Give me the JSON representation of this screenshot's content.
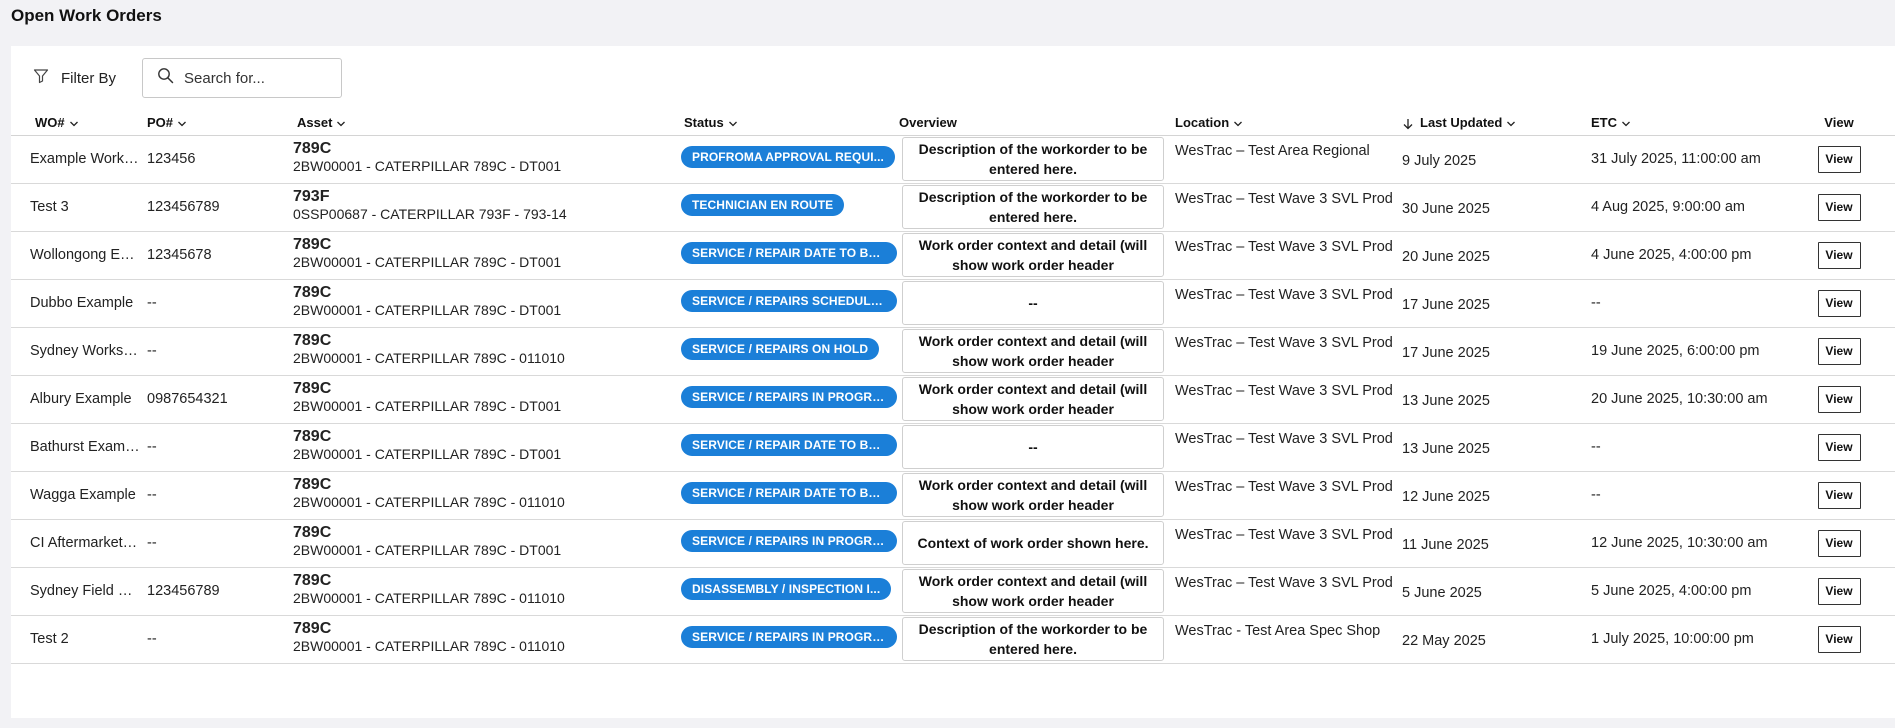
{
  "page": {
    "title": "Open Work Orders"
  },
  "toolbar": {
    "filter_label": "Filter By",
    "search_placeholder": "Search for..."
  },
  "table": {
    "columns": {
      "wo": "WO#",
      "po": "PO#",
      "asset": "Asset",
      "status": "Status",
      "overview": "Overview",
      "location": "Location",
      "updated": "Last Updated",
      "etc": "ETC",
      "view": "View"
    },
    "sorted_column": "Last Updated",
    "sort_direction": "descending",
    "view_label": "View",
    "rows": [
      {
        "wo": "Example Workor...",
        "po": "123456",
        "asset_model": "789C",
        "asset_desc": "2BW00001 - CATERPILLAR 789C - DT001",
        "status": "PROFROMA APPROVAL REQUI...",
        "overview": "Description of the workorder to be entered here.",
        "location": "WesTrac – Test Area Regional",
        "updated": "9 July 2025",
        "etc": "31 July 2025, 11:00:00 am"
      },
      {
        "wo": "Test 3",
        "po": "123456789",
        "asset_model": "793F",
        "asset_desc": "0SSP00687 - CATERPILLAR 793F - 793-14",
        "status": "TECHNICIAN EN ROUTE",
        "overview": "Description of the workorder to be entered here.",
        "location": "WesTrac – Test Wave 3 SVL Prod",
        "updated": "30 June 2025",
        "etc": "4 Aug 2025, 9:00:00 am"
      },
      {
        "wo": "Wollongong Exa...",
        "po": "12345678",
        "asset_model": "789C",
        "asset_desc": "2BW00001 - CATERPILLAR 789C - DT001",
        "status": "SERVICE / REPAIR DATE TO BE S...",
        "overview": "Work order context and detail (will show work order header",
        "location": "WesTrac – Test Wave 3 SVL Prod",
        "updated": "20 June 2025",
        "etc": "4 June 2025, 4:00:00 pm"
      },
      {
        "wo": "Dubbo Example",
        "po": "--",
        "asset_model": "789C",
        "asset_desc": "2BW00001 - CATERPILLAR 789C - DT001",
        "status": "SERVICE / REPAIRS SCHEDULED",
        "overview": "--",
        "location": "WesTrac – Test Wave 3 SVL Prod",
        "updated": "17 June 2025",
        "etc": "--"
      },
      {
        "wo": "Sydney Worksho...",
        "po": "--",
        "asset_model": "789C",
        "asset_desc": "2BW00001 - CATERPILLAR 789C - 011010",
        "status": "SERVICE / REPAIRS ON HOLD",
        "overview": "Work order context and detail (will show work order header",
        "location": "WesTrac – Test Wave 3 SVL Prod",
        "updated": "17 June 2025",
        "etc": "19 June 2025, 6:00:00 pm"
      },
      {
        "wo": "Albury Example",
        "po": "0987654321",
        "asset_model": "789C",
        "asset_desc": "2BW00001 - CATERPILLAR 789C - DT001",
        "status": "SERVICE / REPAIRS IN PROGRESS",
        "overview": "Work order context and detail (will show work order header",
        "location": "WesTrac – Test Wave 3 SVL Prod",
        "updated": "13 June 2025",
        "etc": "20 June 2025, 10:30:00 am"
      },
      {
        "wo": "Bathurst Example",
        "po": "--",
        "asset_model": "789C",
        "asset_desc": "2BW00001 - CATERPILLAR 789C - DT001",
        "status": "SERVICE / REPAIR DATE TO BE S...",
        "overview": "--",
        "location": "WesTrac – Test Wave 3 SVL Prod",
        "updated": "13 June 2025",
        "etc": "--"
      },
      {
        "wo": "Wagga Example",
        "po": "--",
        "asset_model": "789C",
        "asset_desc": "2BW00001 - CATERPILLAR 789C - 011010",
        "status": "SERVICE / REPAIR DATE TO BE S...",
        "overview": "Work order context and detail (will show work order header",
        "location": "WesTrac – Test Wave 3 SVL Prod",
        "updated": "12 June 2025",
        "etc": "--"
      },
      {
        "wo": "CI Aftermarket E...",
        "po": "--",
        "asset_model": "789C",
        "asset_desc": "2BW00001 - CATERPILLAR 789C - DT001",
        "status": "SERVICE / REPAIRS IN PROGRESS",
        "overview": "Context of work order shown here.",
        "location": "WesTrac – Test Wave 3 SVL Prod",
        "updated": "11 June 2025",
        "etc": "12 June 2025, 10:30:00 am"
      },
      {
        "wo": "Sydney Field Ser...",
        "po": "123456789",
        "asset_model": "789C",
        "asset_desc": "2BW00001 - CATERPILLAR 789C - 011010",
        "status": "DISASSEMBLY / INSPECTION I...",
        "overview": "Work order context and detail (will show work order header",
        "location": "WesTrac – Test Wave 3 SVL Prod",
        "updated": "5 June 2025",
        "etc": "5 June 2025, 4:00:00 pm"
      },
      {
        "wo": "Test 2",
        "po": "--",
        "asset_model": "789C",
        "asset_desc": "2BW00001 - CATERPILLAR 789C - 011010",
        "status": "SERVICE / REPAIRS IN PROGRESS",
        "overview": "Description of the workorder to be entered here.",
        "location": "WesTrac - Test Area Spec Shop",
        "updated": "22 May 2025",
        "etc": "1 July 2025, 10:00:00 pm"
      }
    ]
  },
  "colors": {
    "status_badge": "#1b7fd8",
    "page_bg": "#f2f2f5"
  },
  "icons": {
    "filter": "filter-icon",
    "search": "search-icon",
    "sort": "sort-down-arrow-icon",
    "chevron": "chevron-down-icon"
  }
}
